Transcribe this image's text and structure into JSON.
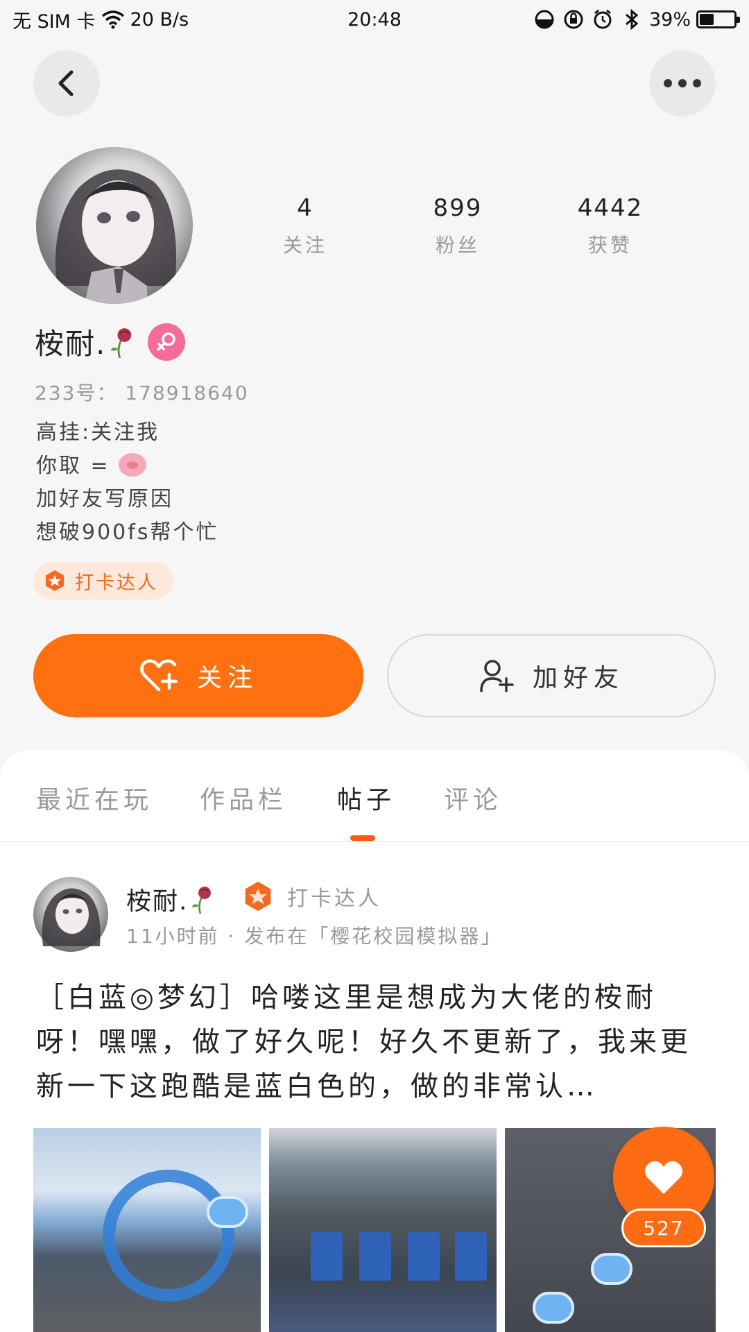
{
  "status_bar": {
    "carrier": "无 SIM 卡",
    "speed": "20 B/s",
    "time": "20:48",
    "battery_percent": "39%",
    "battery_level": 0.39
  },
  "nav": {
    "back_icon": "chevron-left-icon",
    "more_icon": "more-dots-icon"
  },
  "profile": {
    "name": "桉耐.",
    "gender_icon": "female-icon",
    "id_text": "233号： 178918640",
    "stats": [
      {
        "value": "4",
        "label": "关注"
      },
      {
        "value": "899",
        "label": "粉丝"
      },
      {
        "value": "4442",
        "label": "获赞"
      }
    ],
    "bio": {
      "line1": "高挂:关注我",
      "line2": "你取 = ",
      "line3": "加好友写原因",
      "line4": "想破900fs帮个忙"
    },
    "badge": "打卡达人"
  },
  "actions": {
    "follow": "关注",
    "add_friend": "加好友"
  },
  "tabs": [
    {
      "label": "最近在玩"
    },
    {
      "label": "作品栏"
    },
    {
      "label": "帖子",
      "active": true
    },
    {
      "label": "评论"
    }
  ],
  "post": {
    "author": "桉耐.",
    "badge": "打卡达人",
    "meta": "11小时前 · 发布在「樱花校园模拟器」",
    "text": "［白蓝◎梦幻］哈喽这里是想成为大佬的桉耐呀！嘿嘿，做了好久呢！好久不更新了，我来更新一下这跑酷是蓝白色的，做的非常认…",
    "like_count": "527"
  },
  "colors": {
    "accent": "#ff7011",
    "badge_bg": "#fde9dc",
    "gender_pink": "#f56b9a"
  }
}
